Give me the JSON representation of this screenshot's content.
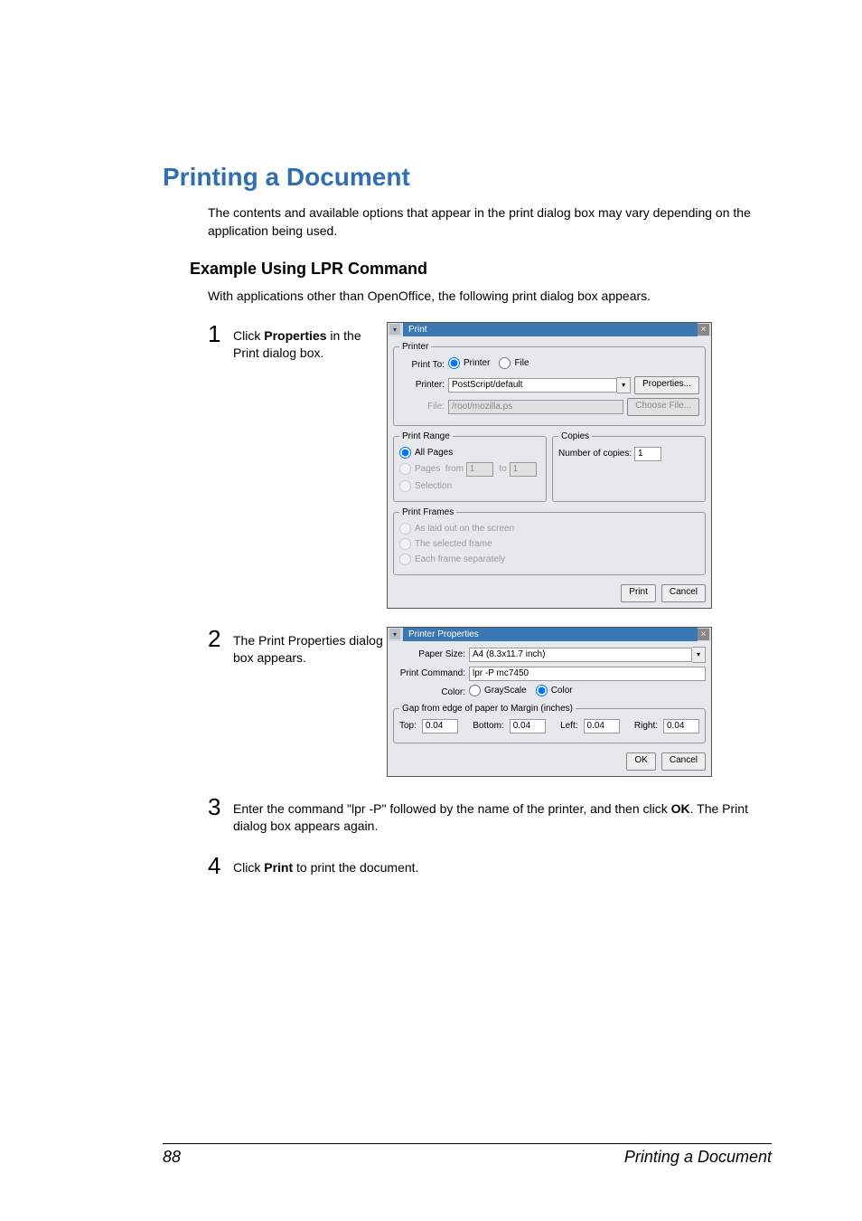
{
  "heading": "Printing a Document",
  "intro": "The contents and available options that appear in the print dialog box may vary depending on the application being used.",
  "subheading": "Example Using LPR Command",
  "subintro": "With applications other than OpenOffice, the following print dialog box appears.",
  "steps": {
    "s1_num": "1",
    "s1_pre": "Click ",
    "s1_bold": "Properties",
    "s1_post": " in the Print dialog box.",
    "s2_num": "2",
    "s2_text": "The Print Properties dialog box appears.",
    "s3_num": "3",
    "s3_pre": "Enter the command \"lpr -P\" followed by the name of the printer, and then click ",
    "s3_bold": "OK",
    "s3_post": ". The Print dialog box appears again.",
    "s4_num": "4",
    "s4_pre": "Click ",
    "s4_bold": "Print",
    "s4_post": " to print the document."
  },
  "dlg1": {
    "title": "Print",
    "printer_grp": "Printer",
    "print_to": "Print To:",
    "opt_printer": "Printer",
    "opt_file": "File",
    "printer_lbl": "Printer:",
    "printer_val": "PostScript/default",
    "properties_btn": "Properties...",
    "file_lbl": "File:",
    "file_val": "/root/mozilla.ps",
    "choose_file_btn": "Choose File...",
    "range_grp": "Print Range",
    "all_pages": "All Pages",
    "pages_lbl": "Pages",
    "from_lbl": "from",
    "from_val": "1",
    "to_lbl": "to",
    "to_val": "1",
    "selection": "Selection",
    "copies_grp": "Copies",
    "copies_lbl": "Number of copies:",
    "copies_val": "1",
    "frames_grp": "Print Frames",
    "f1": "As laid out on the screen",
    "f2": "The selected frame",
    "f3": "Each frame separately",
    "print_btn": "Print",
    "cancel_btn": "Cancel"
  },
  "dlg2": {
    "title": "Printer Properties",
    "paper_size_lbl": "Paper Size:",
    "paper_size_val": "A4 (8.3x11.7 inch)",
    "cmd_lbl": "Print Command:",
    "cmd_val": "lpr -P mc7450",
    "color_lbl": "Color:",
    "grayscale": "GrayScale",
    "color": "Color",
    "gap_grp": "Gap from edge of paper to Margin (inches)",
    "top_lbl": "Top:",
    "top_val": "0.04",
    "bottom_lbl": "Bottom:",
    "bottom_val": "0.04",
    "left_lbl": "Left:",
    "left_val": "0.04",
    "right_lbl": "Right:",
    "right_val": "0.04",
    "ok_btn": "OK",
    "cancel_btn": "Cancel"
  },
  "footer": {
    "page_number": "88",
    "title": "Printing a Document"
  }
}
